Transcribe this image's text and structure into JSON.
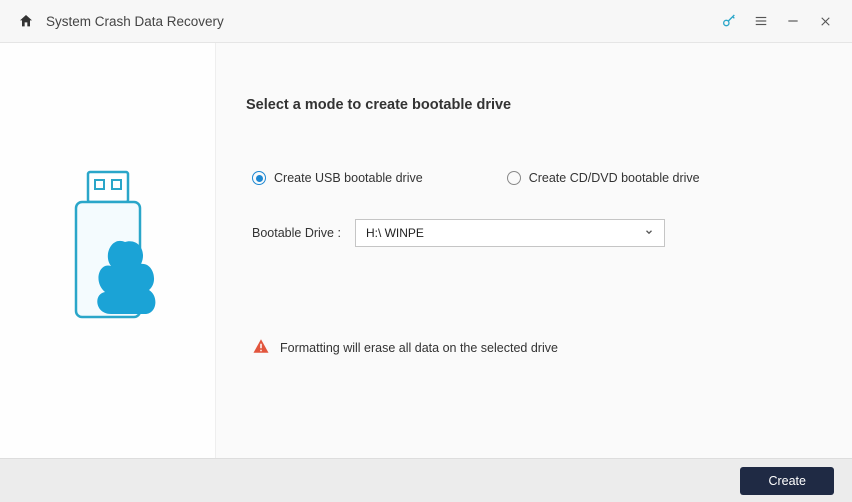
{
  "titlebar": {
    "title": "System Crash Data Recovery"
  },
  "main": {
    "heading": "Select a mode to create bootable drive",
    "options": {
      "usb_label": "Create USB bootable drive",
      "cddvd_label": "Create CD/DVD bootable drive",
      "selected": "usb"
    },
    "drive": {
      "label": "Bootable Drive :",
      "value": "H:\\ WINPE"
    },
    "warning": "Formatting will erase all data on the selected drive"
  },
  "footer": {
    "create_label": "Create"
  }
}
